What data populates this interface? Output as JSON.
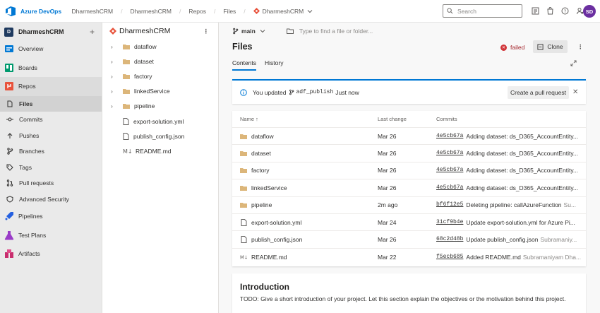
{
  "topbar": {
    "brand": "Azure DevOps",
    "breadcrumb": [
      "DharmeshCRM",
      "DharmeshCRM",
      "Repos",
      "Files",
      "DharmeshCRM"
    ],
    "search_placeholder": "Search",
    "avatar_initials": "SD",
    "icons": [
      "azure-devops-logo",
      "list-icon",
      "shopping-bag-icon",
      "help-icon",
      "user-settings-icon"
    ]
  },
  "nav": {
    "project_badge": "D",
    "project_name": "DharmeshCRM",
    "add": "+",
    "hubs": [
      {
        "label": "Overview",
        "icon": "overview-icon"
      },
      {
        "label": "Boards",
        "icon": "boards-icon"
      },
      {
        "label": "Repos",
        "icon": "repos-icon"
      }
    ],
    "repo_items": [
      {
        "label": "Files",
        "icon": "file-icon"
      },
      {
        "label": "Commits",
        "icon": "commit-icon"
      },
      {
        "label": "Pushes",
        "icon": "push-icon"
      },
      {
        "label": "Branches",
        "icon": "branch-icon"
      },
      {
        "label": "Tags",
        "icon": "tag-icon"
      },
      {
        "label": "Pull requests",
        "icon": "pull-request-icon"
      },
      {
        "label": "Advanced Security",
        "icon": "shield-icon"
      }
    ],
    "more_hubs": [
      {
        "label": "Pipelines",
        "icon": "pipelines-icon"
      },
      {
        "label": "Test Plans",
        "icon": "test-plans-icon"
      },
      {
        "label": "Artifacts",
        "icon": "artifacts-icon"
      }
    ]
  },
  "tree": {
    "repo_name": "DharmeshCRM",
    "more": "⋮",
    "items": [
      {
        "label": "dataflow",
        "type": "folder"
      },
      {
        "label": "dataset",
        "type": "folder"
      },
      {
        "label": "factory",
        "type": "folder"
      },
      {
        "label": "linkedService",
        "type": "folder"
      },
      {
        "label": "pipeline",
        "type": "folder"
      },
      {
        "label": "export-solution.yml",
        "type": "file"
      },
      {
        "label": "publish_config.json",
        "type": "file"
      },
      {
        "label": "README.md",
        "type": "markdown"
      }
    ]
  },
  "main": {
    "branch": "main",
    "path_placeholder": "Type to find a file or folder...",
    "title": "Files",
    "status": "failed",
    "clone_label": "Clone",
    "more": "⋮",
    "tabs": [
      "Contents",
      "History"
    ],
    "banner": {
      "prefix": "You updated",
      "branch": "adf_publish",
      "suffix": "Just now",
      "button": "Create a pull request",
      "close": "✕"
    },
    "table": {
      "headers": {
        "name": "Name ↑",
        "last_change": "Last change",
        "commits": "Commits"
      },
      "rows": [
        {
          "name": "dataflow",
          "type": "folder",
          "last_change": "Mar 26",
          "hash": "4e5cb67a",
          "message": "Adding dataset: ds_D365_AccountEntity...",
          "author": ""
        },
        {
          "name": "dataset",
          "type": "folder",
          "last_change": "Mar 26",
          "hash": "4e5cb67a",
          "message": "Adding dataset: ds_D365_AccountEntity...",
          "author": ""
        },
        {
          "name": "factory",
          "type": "folder",
          "last_change": "Mar 26",
          "hash": "4e5cb67a",
          "message": "Adding dataset: ds_D365_AccountEntity...",
          "author": ""
        },
        {
          "name": "linkedService",
          "type": "folder",
          "last_change": "Mar 26",
          "hash": "4e5cb67a",
          "message": "Adding dataset: ds_D365_AccountEntity...",
          "author": ""
        },
        {
          "name": "pipeline",
          "type": "folder",
          "last_change": "2m ago",
          "hash": "bf6f12e5",
          "message": "Deleting pipeline: callAzureFunction",
          "author": "Su..."
        },
        {
          "name": "export-solution.yml",
          "type": "file",
          "last_change": "Mar 24",
          "hash": "31cf9b4e",
          "message": "Update export-solution.yml for Azure Pi...",
          "author": ""
        },
        {
          "name": "publish_config.json",
          "type": "file",
          "last_change": "Mar 26",
          "hash": "68c2d48b",
          "message": "Update publish_config.json",
          "author": "Subramaniy..."
        },
        {
          "name": "README.md",
          "type": "markdown",
          "last_change": "Mar 22",
          "hash": "f5ecb685",
          "message": "Added README.md",
          "author": "Subramaniyam Dha..."
        }
      ]
    },
    "readme": {
      "title": "Introduction",
      "body": "TODO: Give a short introduction of your project. Let this section explain the objectives or the motivation behind this project."
    }
  },
  "colors": {
    "accent": "#0078d4",
    "failed": "#d13438",
    "folder": "#dcb67a"
  }
}
